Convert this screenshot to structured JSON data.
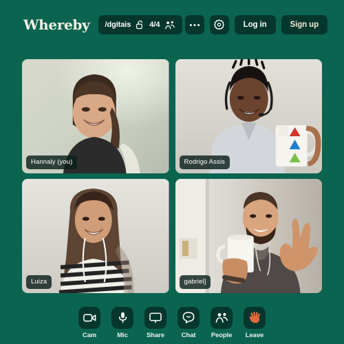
{
  "app": {
    "brand": "Whereby",
    "background_color": "#0a6450",
    "surface_color": "#06372d",
    "accent_text_color": "#f3e9d2"
  },
  "header": {
    "room": {
      "name": "/dgitais",
      "lock_icon": "unlocked-padlock-icon",
      "participant_count": "4/4",
      "people_icon": "people-icon"
    },
    "actions": [
      {
        "name": "more-options-button",
        "icon": "ellipsis-icon",
        "label": ""
      },
      {
        "name": "settings-button",
        "icon": "gear-icon",
        "label": ""
      },
      {
        "name": "log-in-button",
        "icon": "",
        "label": "Log in"
      },
      {
        "name": "sign-up-button",
        "icon": "",
        "label": "Sign up"
      }
    ],
    "log_in_label": "Log in",
    "sign_up_label": "Sign up"
  },
  "grid": {
    "participants": [
      {
        "name": "Hannaly (you)",
        "is_self": true
      },
      {
        "name": "Rodrigo Assis",
        "is_self": false
      },
      {
        "name": "Luiza",
        "is_self": false
      },
      {
        "name": "gabriel]",
        "is_self": false
      }
    ]
  },
  "toolbar": {
    "items": [
      {
        "icon": "camera-icon",
        "label": "Cam"
      },
      {
        "icon": "microphone-icon",
        "label": "Mic"
      },
      {
        "icon": "monitor-icon",
        "label": "Share"
      },
      {
        "icon": "chat-bubble-icon",
        "label": "Chat"
      },
      {
        "icon": "people-icon",
        "label": "People"
      },
      {
        "icon": "waving-hand-icon",
        "label": "Leave"
      }
    ]
  }
}
